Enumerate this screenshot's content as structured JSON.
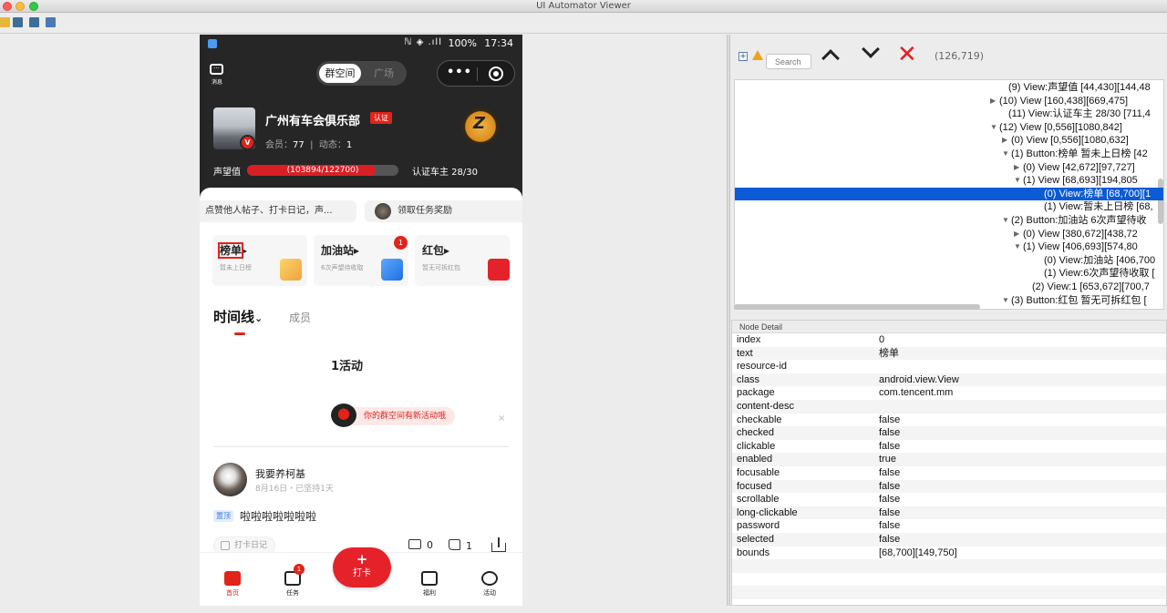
{
  "window": {
    "title": "UI Automator Viewer"
  },
  "phone": {
    "status": {
      "signal": "ℕ ◈ .ıll",
      "battery": "100%",
      "time": "17:34"
    },
    "message_label": "消息",
    "segment": {
      "active": "群空间",
      "inactive": "广场"
    },
    "capsule": {
      "more": "•••"
    },
    "group": {
      "name": "广州有车会俱乐部",
      "cert": "认证",
      "members_label": "会员：",
      "members": "77",
      "posts_label": "动态：",
      "posts": "1",
      "vbadge": "V",
      "emblem": "Z"
    },
    "reputation": {
      "label": "声望值",
      "text": "(103894/122700)",
      "value": 103894,
      "max": 122700
    },
    "car_owner": "认证车主 28/30",
    "pill_left": "点赞他人帖子、打卡日记，声...",
    "pill_right": "领取任务奖励",
    "cards": [
      {
        "title": "榜单",
        "arrow": "▸",
        "sub": "暂未上日榜"
      },
      {
        "title": "加油站",
        "arrow": "▸",
        "sub": "6次声望待收取",
        "badge": "1"
      },
      {
        "title": "红包",
        "arrow": "▸",
        "sub": "暂无可拆红包"
      }
    ],
    "tabs": {
      "timeline": "时间线",
      "chevron": "⌄",
      "members": "成员"
    },
    "activity_count": "1活动",
    "new_activity": "你的群空间有新活动哦",
    "close": "×",
    "post": {
      "author": "我要养柯基",
      "date": "8月16日・已坚持1天",
      "pin": "置顶",
      "text": "啦啦啦啦啦啦啦",
      "diary": "打卡日记",
      "comments": "0",
      "likes": "1"
    },
    "bottom_nav": {
      "home": "首页",
      "tasks": "任务",
      "tasks_badge": "1",
      "punch_plus": "+",
      "punch": "打卡",
      "welfare": "福利",
      "activity": "活动"
    }
  },
  "toolbar": {
    "coords": "(126,719)",
    "search_placeholder": "Search",
    "expand": "+"
  },
  "tree": [
    {
      "indent": 300,
      "arrow": "",
      "text": "(9) View:声望值 [44,430][144,48"
    },
    {
      "indent": 290,
      "arrow": "▶",
      "text": "(10) View [160,438][669,475]"
    },
    {
      "indent": 300,
      "arrow": "",
      "text": "(11) View:认证车主 28/30 [711,4"
    },
    {
      "indent": 290,
      "arrow": "▼",
      "text": "(12) View [0,556][1080,842]"
    },
    {
      "indent": 303,
      "arrow": "▶",
      "text": "(0) View [0,556][1080,632]"
    },
    {
      "indent": 303,
      "arrow": "▼",
      "text": "(1) Button:榜单 暂未上日榜 [42"
    },
    {
      "indent": 316,
      "arrow": "▶",
      "text": "(0) View [42,672][97,727]"
    },
    {
      "indent": 316,
      "arrow": "▼",
      "text": "(1) View [68,693][194,805"
    },
    {
      "indent": 339,
      "arrow": "",
      "text": "(0) View:榜单 [68,700][1",
      "selected": true
    },
    {
      "indent": 339,
      "arrow": "",
      "text": "(1) View:暂未上日榜 [68,"
    },
    {
      "indent": 303,
      "arrow": "▼",
      "text": "(2) Button:加油站 6次声望待收"
    },
    {
      "indent": 316,
      "arrow": "▶",
      "text": "(0) View [380,672][438,72"
    },
    {
      "indent": 316,
      "arrow": "▼",
      "text": "(1) View [406,693][574,80"
    },
    {
      "indent": 339,
      "arrow": "",
      "text": "(0) View:加油站 [406,700"
    },
    {
      "indent": 339,
      "arrow": "",
      "text": "(1) View:6次声望待收取 ["
    },
    {
      "indent": 326,
      "arrow": "",
      "text": "(2) View:1 [653,672][700,7"
    },
    {
      "indent": 303,
      "arrow": "▼",
      "text": "(3) Button:红包 暂无可拆红包 ["
    }
  ],
  "node_detail": {
    "header": "Node Detail",
    "rows": [
      {
        "k": "index",
        "v": "0"
      },
      {
        "k": "text",
        "v": "榜单"
      },
      {
        "k": "resource-id",
        "v": ""
      },
      {
        "k": "class",
        "v": "android.view.View"
      },
      {
        "k": "package",
        "v": "com.tencent.mm"
      },
      {
        "k": "content-desc",
        "v": ""
      },
      {
        "k": "checkable",
        "v": "false"
      },
      {
        "k": "checked",
        "v": "false"
      },
      {
        "k": "clickable",
        "v": "false"
      },
      {
        "k": "enabled",
        "v": "true"
      },
      {
        "k": "focusable",
        "v": "false"
      },
      {
        "k": "focused",
        "v": "false"
      },
      {
        "k": "scrollable",
        "v": "false"
      },
      {
        "k": "long-clickable",
        "v": "false"
      },
      {
        "k": "password",
        "v": "false"
      },
      {
        "k": "selected",
        "v": "false"
      },
      {
        "k": "bounds",
        "v": "[68,700][149,750]"
      }
    ]
  }
}
